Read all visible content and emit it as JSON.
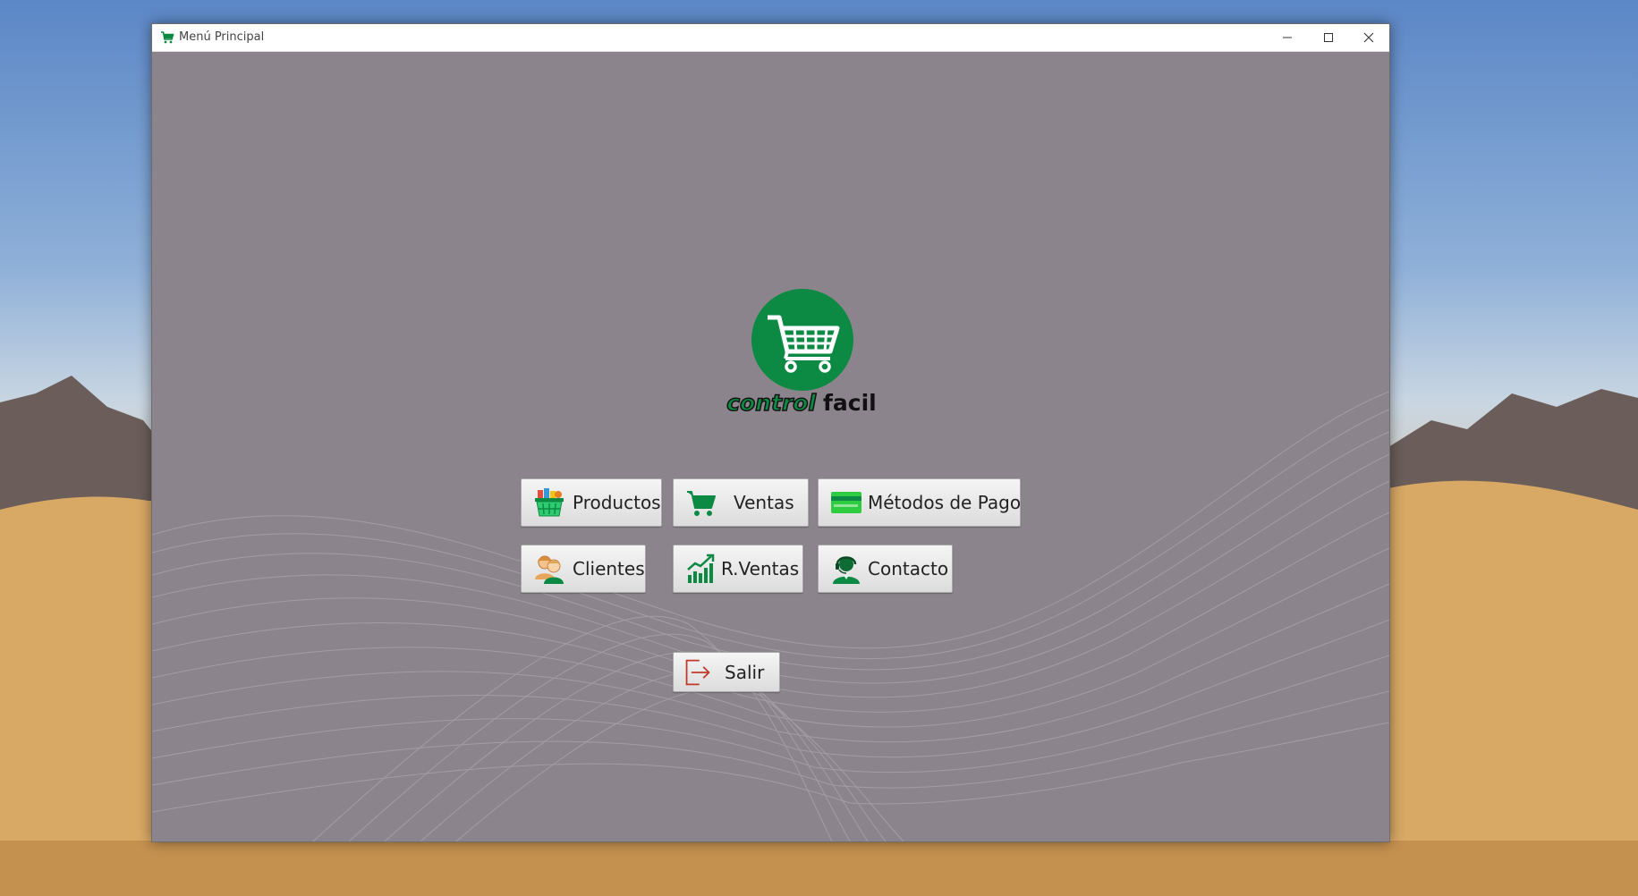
{
  "window": {
    "title": "Menú Principal",
    "controls": [
      "minimize",
      "maximize",
      "close"
    ]
  },
  "logo": {
    "word1": "control",
    "word2": "facil",
    "brand_color": "#0c8a43"
  },
  "buttons": {
    "productos": {
      "label": "Productos",
      "icon": "grocery-basket-icon"
    },
    "ventas": {
      "label": "Ventas",
      "icon": "shopping-cart-icon"
    },
    "metodos_pago": {
      "label": "Métodos de Pago",
      "icon": "credit-card-icon"
    },
    "clientes": {
      "label": "Clientes",
      "icon": "users-icon"
    },
    "rventas": {
      "label": "R.Ventas",
      "icon": "sales-chart-icon"
    },
    "contacto": {
      "label": "Contacto",
      "icon": "support-agent-icon"
    },
    "salir": {
      "label": "Salir",
      "icon": "exit-icon"
    }
  },
  "colors": {
    "content_background": "#8b848c",
    "accent_green": "#0c8a43",
    "exit_red": "#c0392b"
  }
}
